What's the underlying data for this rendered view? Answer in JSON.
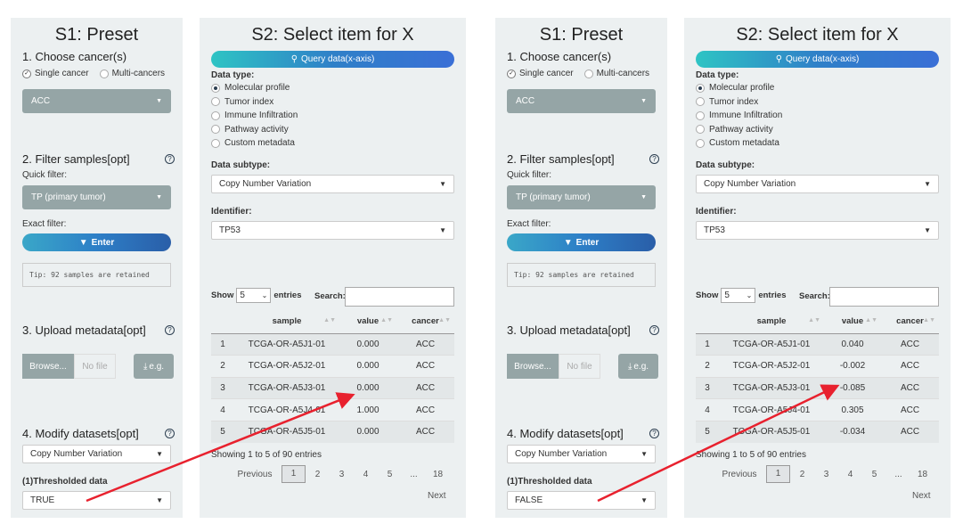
{
  "arrow_color": "#e8212e",
  "panels": [
    {
      "preset": {
        "title": "S1: Preset",
        "choose_cancer": "1. Choose cancer(s)",
        "single_cancer": "Single cancer",
        "multi_cancers": "Multi-cancers",
        "cancer_select": "ACC",
        "filter_samples": "2. Filter samples[opt]",
        "quick_filter_label": "Quick filter:",
        "quick_filter_value": "TP (primary tumor)",
        "exact_filter_label": "Exact filter:",
        "enter_button": "Enter",
        "tip": "Tip: 92 samples are retained",
        "upload_metadata": "3. Upload metadata[opt]",
        "browse_button": "Browse...",
        "no_file": "No file",
        "eg_button": "e.g.",
        "modify_datasets": "4. Modify datasets[opt]",
        "dataset_select": "Copy Number Variation",
        "thresholded_label": "(1)Thresholded data",
        "thresholded_value": "TRUE"
      },
      "select": {
        "title": "S2: Select item for X",
        "query_button": "Query data(x-axis)",
        "data_type_label": "Data type:",
        "data_types": [
          "Molecular profile",
          "Tumor index",
          "Immune Infiltration",
          "Pathway activity",
          "Custom metadata"
        ],
        "data_subtype_label": "Data subtype:",
        "data_subtype_value": "Copy Number Variation",
        "identifier_label": "Identifier:",
        "identifier_value": "TP53",
        "show_label": "Show",
        "show_value": "5",
        "entries_label": "entries",
        "search_label": "Search:",
        "columns": [
          "sample",
          "value",
          "cancer"
        ],
        "rows": [
          [
            "1",
            "TCGA-OR-A5J1-01",
            "0.000",
            "ACC"
          ],
          [
            "2",
            "TCGA-OR-A5J2-01",
            "0.000",
            "ACC"
          ],
          [
            "3",
            "TCGA-OR-A5J3-01",
            "0.000",
            "ACC"
          ],
          [
            "4",
            "TCGA-OR-A5J4-01",
            "1.000",
            "ACC"
          ],
          [
            "5",
            "TCGA-OR-A5J5-01",
            "0.000",
            "ACC"
          ]
        ],
        "info": "Showing 1 to 5 of 90 entries",
        "previous": "Previous",
        "pages": [
          "1",
          "2",
          "3",
          "4",
          "5",
          "...",
          "18"
        ],
        "next": "Next"
      }
    },
    {
      "preset": {
        "title": "S1: Preset",
        "choose_cancer": "1. Choose cancer(s)",
        "single_cancer": "Single cancer",
        "multi_cancers": "Multi-cancers",
        "cancer_select": "ACC",
        "filter_samples": "2. Filter samples[opt]",
        "quick_filter_label": "Quick filter:",
        "quick_filter_value": "TP (primary tumor)",
        "exact_filter_label": "Exact filter:",
        "enter_button": "Enter",
        "tip": "Tip: 92 samples are retained",
        "upload_metadata": "3. Upload metadata[opt]",
        "browse_button": "Browse...",
        "no_file": "No file",
        "eg_button": "e.g.",
        "modify_datasets": "4. Modify datasets[opt]",
        "dataset_select": "Copy Number Variation",
        "thresholded_label": "(1)Thresholded data",
        "thresholded_value": "FALSE"
      },
      "select": {
        "title": "S2: Select item for X",
        "query_button": "Query data(x-axis)",
        "data_type_label": "Data type:",
        "data_types": [
          "Molecular profile",
          "Tumor index",
          "Immune Infiltration",
          "Pathway activity",
          "Custom metadata"
        ],
        "data_subtype_label": "Data subtype:",
        "data_subtype_value": "Copy Number Variation",
        "identifier_label": "Identifier:",
        "identifier_value": "TP53",
        "show_label": "Show",
        "show_value": "5",
        "entries_label": "entries",
        "search_label": "Search:",
        "columns": [
          "sample",
          "value",
          "cancer"
        ],
        "rows": [
          [
            "1",
            "TCGA-OR-A5J1-01",
            "0.040",
            "ACC"
          ],
          [
            "2",
            "TCGA-OR-A5J2-01",
            "-0.002",
            "ACC"
          ],
          [
            "3",
            "TCGA-OR-A5J3-01",
            "-0.085",
            "ACC"
          ],
          [
            "4",
            "TCGA-OR-A5J4-01",
            "0.305",
            "ACC"
          ],
          [
            "5",
            "TCGA-OR-A5J5-01",
            "-0.034",
            "ACC"
          ]
        ],
        "info": "Showing 1 to 5 of 90 entries",
        "previous": "Previous",
        "pages": [
          "1",
          "2",
          "3",
          "4",
          "5",
          "...",
          "18"
        ],
        "next": "Next"
      }
    }
  ]
}
